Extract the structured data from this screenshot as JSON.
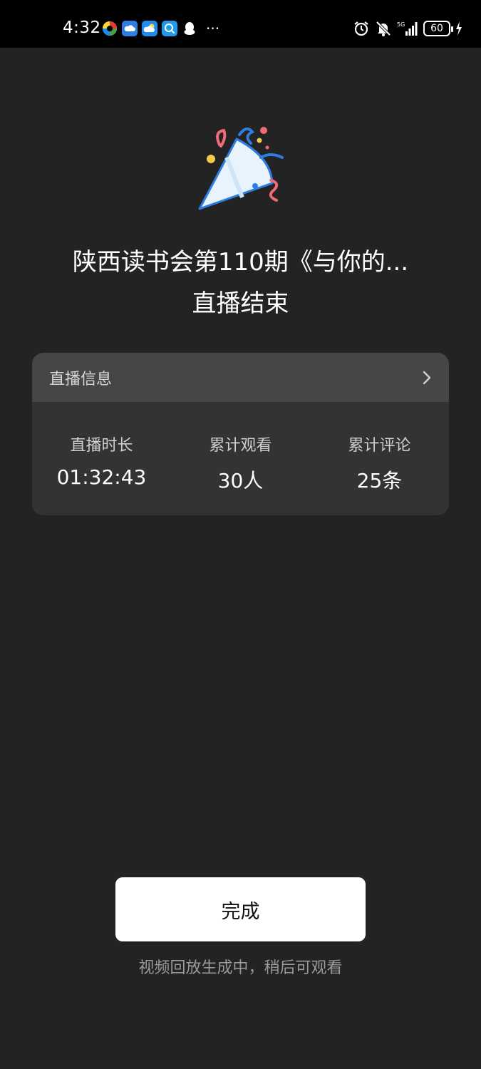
{
  "status_bar": {
    "time": "4:32",
    "notification_icons": [
      "app-icon",
      "cloud-icon",
      "weather-icon",
      "search-app-icon",
      "qq-icon"
    ],
    "more": "···",
    "system_icons": [
      "alarm-icon",
      "mute-icon",
      "signal-5g-icon"
    ],
    "network": "5G",
    "battery": "60"
  },
  "header": {
    "illustration": "party-popper-icon",
    "title": "陕西读书会第110期《与你的...",
    "subtitle": "直播结束"
  },
  "info_card": {
    "title": "直播信息",
    "stats": [
      {
        "label": "直播时长",
        "value": "01:32:43"
      },
      {
        "label": "累计观看",
        "value": "30人"
      },
      {
        "label": "累计评论",
        "value": "25条"
      }
    ]
  },
  "footer": {
    "done_label": "完成",
    "hint": "视频回放生成中，稍后可观看"
  },
  "colors": {
    "background": "#232323",
    "card": "#333333",
    "card_header": "#464646",
    "button": "#ffffff"
  }
}
